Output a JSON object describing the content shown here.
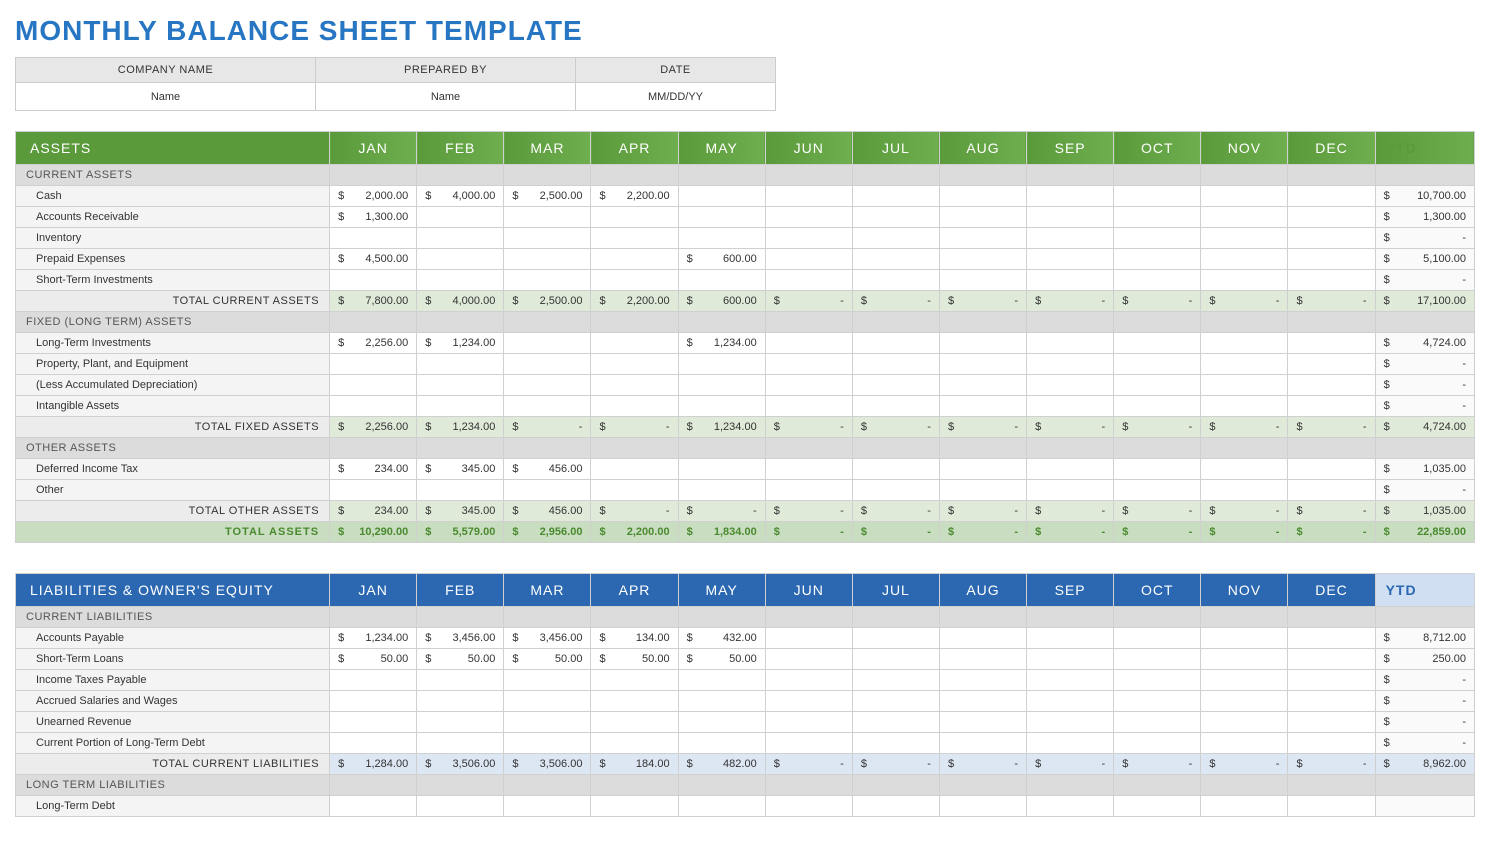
{
  "title": "MONTHLY BALANCE SHEET TEMPLATE",
  "info": {
    "headers": [
      "COMPANY NAME",
      "PREPARED BY",
      "DATE"
    ],
    "values": [
      "Name",
      "Name",
      "MM/DD/YY"
    ]
  },
  "months": [
    "JAN",
    "FEB",
    "MAR",
    "APR",
    "MAY",
    "JUN",
    "JUL",
    "AUG",
    "SEP",
    "OCT",
    "NOV",
    "DEC"
  ],
  "ytd_label": "YTD",
  "sections": [
    {
      "id": "assets",
      "color": "green",
      "title": "ASSETS",
      "groups": [
        {
          "header": "CURRENT ASSETS",
          "rows": [
            {
              "label": "Cash",
              "vals": [
                "2,000.00",
                "4,000.00",
                "2,500.00",
                "2,200.00",
                "",
                "",
                "",
                "",
                "",
                "",
                "",
                ""
              ],
              "ytd": "10,700.00"
            },
            {
              "label": "Accounts Receivable",
              "vals": [
                "1,300.00",
                "",
                "",
                "",
                "",
                "",
                "",
                "",
                "",
                "",
                "",
                ""
              ],
              "ytd": "1,300.00"
            },
            {
              "label": "Inventory",
              "vals": [
                "",
                "",
                "",
                "",
                "",
                "",
                "",
                "",
                "",
                "",
                "",
                ""
              ],
              "ytd": "-"
            },
            {
              "label": "Prepaid Expenses",
              "vals": [
                "4,500.00",
                "",
                "",
                "",
                "600.00",
                "",
                "",
                "",
                "",
                "",
                "",
                ""
              ],
              "ytd": "5,100.00"
            },
            {
              "label": "Short-Term Investments",
              "vals": [
                "",
                "",
                "",
                "",
                "",
                "",
                "",
                "",
                "",
                "",
                "",
                ""
              ],
              "ytd": "-"
            }
          ],
          "subtotal": {
            "label": "TOTAL CURRENT ASSETS",
            "vals": [
              "7,800.00",
              "4,000.00",
              "2,500.00",
              "2,200.00",
              "600.00",
              "-",
              "-",
              "-",
              "-",
              "-",
              "-",
              "-"
            ],
            "ytd": "17,100.00"
          }
        },
        {
          "header": "FIXED (LONG TERM) ASSETS",
          "rows": [
            {
              "label": "Long-Term Investments",
              "vals": [
                "2,256.00",
                "1,234.00",
                "",
                "",
                "1,234.00",
                "",
                "",
                "",
                "",
                "",
                "",
                ""
              ],
              "ytd": "4,724.00"
            },
            {
              "label": "Property, Plant, and Equipment",
              "vals": [
                "",
                "",
                "",
                "",
                "",
                "",
                "",
                "",
                "",
                "",
                "",
                ""
              ],
              "ytd": "-"
            },
            {
              "label": "(Less Accumulated Depreciation)",
              "vals": [
                "",
                "",
                "",
                "",
                "",
                "",
                "",
                "",
                "",
                "",
                "",
                ""
              ],
              "ytd": "-"
            },
            {
              "label": "Intangible Assets",
              "vals": [
                "",
                "",
                "",
                "",
                "",
                "",
                "",
                "",
                "",
                "",
                "",
                ""
              ],
              "ytd": "-"
            }
          ],
          "subtotal": {
            "label": "TOTAL FIXED ASSETS",
            "vals": [
              "2,256.00",
              "1,234.00",
              "-",
              "-",
              "1,234.00",
              "-",
              "-",
              "-",
              "-",
              "-",
              "-",
              "-"
            ],
            "ytd": "4,724.00"
          }
        },
        {
          "header": "OTHER ASSETS",
          "rows": [
            {
              "label": "Deferred Income Tax",
              "vals": [
                "234.00",
                "345.00",
                "456.00",
                "",
                "",
                "",
                "",
                "",
                "",
                "",
                "",
                ""
              ],
              "ytd": "1,035.00"
            },
            {
              "label": "Other",
              "vals": [
                "",
                "",
                "",
                "",
                "",
                "",
                "",
                "",
                "",
                "",
                "",
                ""
              ],
              "ytd": "-"
            }
          ],
          "subtotal": {
            "label": "TOTAL OTHER ASSETS",
            "vals": [
              "234.00",
              "345.00",
              "456.00",
              "-",
              "-",
              "-",
              "-",
              "-",
              "-",
              "-",
              "-",
              "-"
            ],
            "ytd": "1,035.00"
          }
        }
      ],
      "grand": {
        "label": "TOTAL ASSETS",
        "vals": [
          "10,290.00",
          "5,579.00",
          "2,956.00",
          "2,200.00",
          "1,834.00",
          "-",
          "-",
          "-",
          "-",
          "-",
          "-",
          "-"
        ],
        "ytd": "22,859.00"
      }
    },
    {
      "id": "liabilities",
      "color": "blue",
      "title": "LIABILITIES & OWNER'S EQUITY",
      "groups": [
        {
          "header": "CURRENT LIABILITIES",
          "rows": [
            {
              "label": "Accounts Payable",
              "vals": [
                "1,234.00",
                "3,456.00",
                "3,456.00",
                "134.00",
                "432.00",
                "",
                "",
                "",
                "",
                "",
                "",
                ""
              ],
              "ytd": "8,712.00"
            },
            {
              "label": "Short-Term Loans",
              "vals": [
                "50.00",
                "50.00",
                "50.00",
                "50.00",
                "50.00",
                "",
                "",
                "",
                "",
                "",
                "",
                ""
              ],
              "ytd": "250.00"
            },
            {
              "label": "Income Taxes Payable",
              "vals": [
                "",
                "",
                "",
                "",
                "",
                "",
                "",
                "",
                "",
                "",
                "",
                ""
              ],
              "ytd": "-"
            },
            {
              "label": "Accrued Salaries and Wages",
              "vals": [
                "",
                "",
                "",
                "",
                "",
                "",
                "",
                "",
                "",
                "",
                "",
                ""
              ],
              "ytd": "-"
            },
            {
              "label": "Unearned Revenue",
              "vals": [
                "",
                "",
                "",
                "",
                "",
                "",
                "",
                "",
                "",
                "",
                "",
                ""
              ],
              "ytd": "-"
            },
            {
              "label": "Current Portion of Long-Term Debt",
              "vals": [
                "",
                "",
                "",
                "",
                "",
                "",
                "",
                "",
                "",
                "",
                "",
                ""
              ],
              "ytd": "-"
            }
          ],
          "subtotal": {
            "label": "TOTAL CURRENT LIABILITIES",
            "vals": [
              "1,284.00",
              "3,506.00",
              "3,506.00",
              "184.00",
              "482.00",
              "-",
              "-",
              "-",
              "-",
              "-",
              "-",
              "-"
            ],
            "ytd": "8,962.00"
          }
        },
        {
          "header": "LONG TERM LIABILITIES",
          "rows": [
            {
              "label": "Long-Term Debt",
              "vals": [
                "",
                "",
                "",
                "",
                "",
                "",
                "",
                "",
                "",
                "",
                "",
                ""
              ],
              "ytd": ""
            }
          ]
        }
      ]
    }
  ]
}
